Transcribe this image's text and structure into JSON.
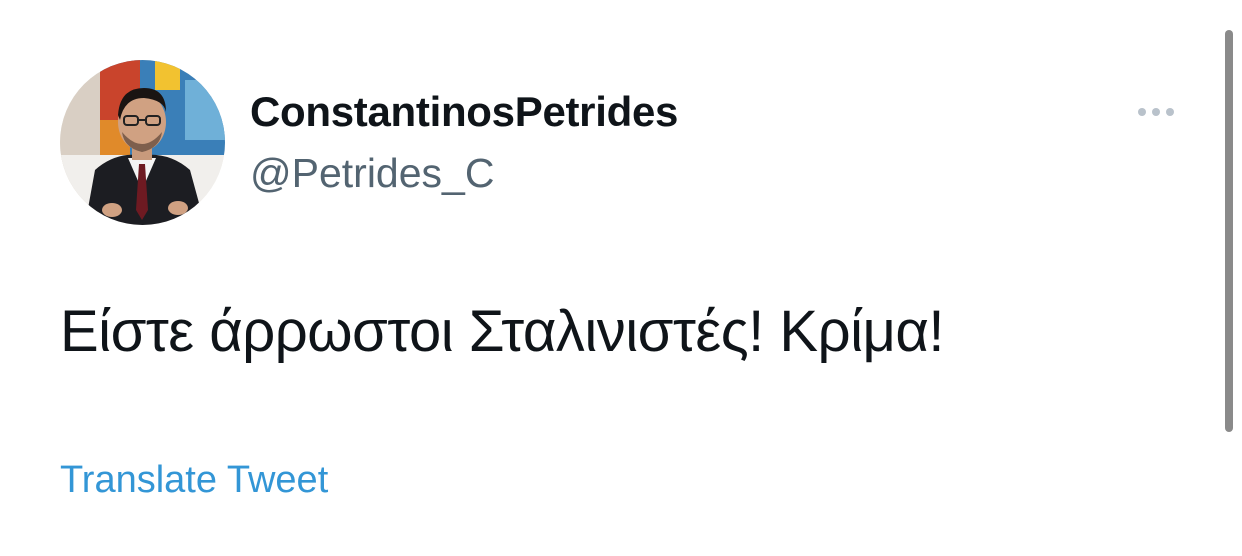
{
  "author": {
    "display_name": "ConstantinosPetrides",
    "handle": "@Petrides_C",
    "avatar_icon": "profile-photo"
  },
  "tweet": {
    "text": "Είστε άρρωστοι Σταλινιστές! Κρίμα!"
  },
  "actions": {
    "translate_label": "Translate Tweet",
    "more_icon": "more-horizontal-icon"
  },
  "colors": {
    "text_primary": "#0f1419",
    "text_secondary": "#536471",
    "link": "#3396d6",
    "more_dots": "#b9c2cb",
    "scrollbar": "#8a8a8a"
  }
}
